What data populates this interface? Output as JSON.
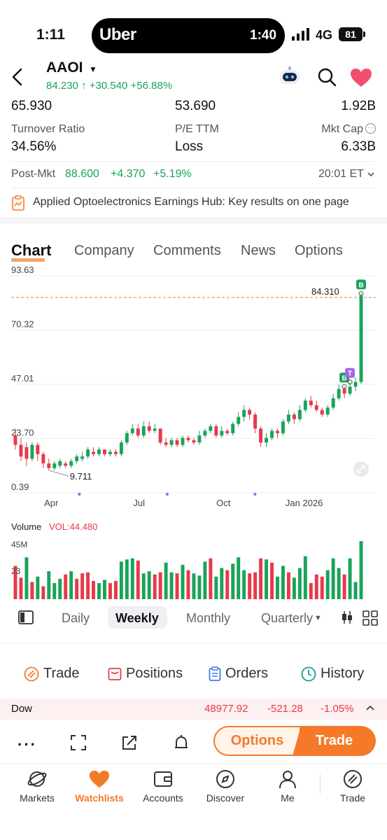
{
  "status_bar": {
    "time": "1:11",
    "island_brand": "Uber",
    "island_time": "1:40",
    "network": "4G",
    "battery": "81"
  },
  "header": {
    "ticker": "AAOI",
    "price": "84.230",
    "change": "+30.540",
    "change_pct": "+56.88%"
  },
  "stats": {
    "row1": [
      "65.930",
      "53.690",
      "1.92B"
    ],
    "row2_labels": [
      "Turnover Ratio",
      "P/E TTM",
      "Mkt Cap"
    ],
    "row2_values": [
      "34.56%",
      "Loss",
      "6.33B"
    ]
  },
  "post_market": {
    "label": "Post-Mkt",
    "price": "88.600",
    "change": "+4.370",
    "change_pct": "+5.19%",
    "time": "20:01 ET"
  },
  "banner": {
    "text": "Applied Optoelectronics Earnings Hub: Key results on one page"
  },
  "tabs": [
    "Chart",
    "Company",
    "Comments",
    "News",
    "Options"
  ],
  "chart_data": {
    "type": "candlestick",
    "y_ticks": [
      "93.63",
      "70.32",
      "47.01",
      "23.70",
      "0.39"
    ],
    "x_ticks": [
      "Apr",
      "Jul",
      "Oct",
      "Jan 2026"
    ],
    "ylim": [
      0.39,
      93.63
    ],
    "last_price_line": "84.310",
    "low_label": "9.711",
    "markers": [
      "B",
      "B",
      "T"
    ],
    "volume_label": "Volume",
    "volume_value": "VOL:44.480",
    "volume_ticks": [
      "45M",
      "23"
    ],
    "candles": [
      {
        "o": 25,
        "c": 21,
        "h": 28,
        "l": 19
      },
      {
        "o": 21,
        "c": 16,
        "h": 24,
        "l": 14
      },
      {
        "o": 20,
        "c": 15,
        "h": 22,
        "l": 12
      },
      {
        "o": 15,
        "c": 21,
        "h": 22,
        "l": 14
      },
      {
        "o": 21,
        "c": 17,
        "h": 22,
        "l": 14
      },
      {
        "o": 17,
        "c": 13,
        "h": 18,
        "l": 11
      },
      {
        "o": 13,
        "c": 11,
        "h": 15,
        "l": 10
      },
      {
        "o": 11,
        "c": 13,
        "h": 14,
        "l": 10
      },
      {
        "o": 12,
        "c": 14,
        "h": 15,
        "l": 11
      },
      {
        "o": 13,
        "c": 12,
        "h": 14,
        "l": 11
      },
      {
        "o": 12,
        "c": 14,
        "h": 15,
        "l": 11
      },
      {
        "o": 14,
        "c": 16,
        "h": 17,
        "l": 13
      },
      {
        "o": 15,
        "c": 16,
        "h": 18,
        "l": 14
      },
      {
        "o": 16,
        "c": 19,
        "h": 20,
        "l": 15
      },
      {
        "o": 18,
        "c": 17,
        "h": 20,
        "l": 16
      },
      {
        "o": 17,
        "c": 19,
        "h": 20,
        "l": 16
      },
      {
        "o": 19,
        "c": 17,
        "h": 19,
        "l": 16
      },
      {
        "o": 17,
        "c": 18,
        "h": 19,
        "l": 16
      },
      {
        "o": 18,
        "c": 17,
        "h": 19,
        "l": 16
      },
      {
        "o": 17,
        "c": 22,
        "h": 23,
        "l": 16
      },
      {
        "o": 22,
        "c": 26,
        "h": 27,
        "l": 21
      },
      {
        "o": 26,
        "c": 28,
        "h": 30,
        "l": 25
      },
      {
        "o": 28,
        "c": 25,
        "h": 30,
        "l": 24
      },
      {
        "o": 25,
        "c": 29,
        "h": 31,
        "l": 24
      },
      {
        "o": 29,
        "c": 27,
        "h": 31,
        "l": 26
      },
      {
        "o": 27,
        "c": 28,
        "h": 30,
        "l": 26
      },
      {
        "o": 28,
        "c": 22,
        "h": 28,
        "l": 21
      },
      {
        "o": 22,
        "c": 21,
        "h": 24,
        "l": 20
      },
      {
        "o": 21,
        "c": 23,
        "h": 24,
        "l": 20
      },
      {
        "o": 23,
        "c": 21,
        "h": 24,
        "l": 20
      },
      {
        "o": 21,
        "c": 24,
        "h": 25,
        "l": 20
      },
      {
        "o": 24,
        "c": 23,
        "h": 25,
        "l": 22
      },
      {
        "o": 23,
        "c": 22,
        "h": 24,
        "l": 21
      },
      {
        "o": 22,
        "c": 25,
        "h": 27,
        "l": 21
      },
      {
        "o": 25,
        "c": 27,
        "h": 28,
        "l": 24
      },
      {
        "o": 27,
        "c": 29,
        "h": 30,
        "l": 26
      },
      {
        "o": 29,
        "c": 25,
        "h": 30,
        "l": 24
      },
      {
        "o": 25,
        "c": 27,
        "h": 29,
        "l": 24
      },
      {
        "o": 27,
        "c": 26,
        "h": 28,
        "l": 25
      },
      {
        "o": 26,
        "c": 30,
        "h": 31,
        "l": 25
      },
      {
        "o": 30,
        "c": 33,
        "h": 35,
        "l": 29
      },
      {
        "o": 33,
        "c": 36,
        "h": 38,
        "l": 31
      },
      {
        "o": 36,
        "c": 34,
        "h": 37,
        "l": 32
      },
      {
        "o": 34,
        "c": 28,
        "h": 35,
        "l": 26
      },
      {
        "o": 28,
        "c": 22,
        "h": 29,
        "l": 20
      },
      {
        "o": 22,
        "c": 24,
        "h": 26,
        "l": 20
      },
      {
        "o": 24,
        "c": 27,
        "h": 28,
        "l": 23
      },
      {
        "o": 27,
        "c": 26,
        "h": 28,
        "l": 24
      },
      {
        "o": 26,
        "c": 31,
        "h": 32,
        "l": 25
      },
      {
        "o": 31,
        "c": 34,
        "h": 36,
        "l": 30
      },
      {
        "o": 34,
        "c": 32,
        "h": 35,
        "l": 30
      },
      {
        "o": 32,
        "c": 36,
        "h": 38,
        "l": 31
      },
      {
        "o": 36,
        "c": 40,
        "h": 41,
        "l": 35
      },
      {
        "o": 40,
        "c": 38,
        "h": 42,
        "l": 37
      },
      {
        "o": 38,
        "c": 36,
        "h": 40,
        "l": 35
      },
      {
        "o": 36,
        "c": 34,
        "h": 37,
        "l": 33
      },
      {
        "o": 34,
        "c": 37,
        "h": 38,
        "l": 33
      },
      {
        "o": 37,
        "c": 41,
        "h": 43,
        "l": 36
      },
      {
        "o": 41,
        "c": 45,
        "h": 47,
        "l": 40
      },
      {
        "o": 45,
        "c": 43,
        "h": 46,
        "l": 41
      },
      {
        "o": 43,
        "c": 46,
        "h": 48,
        "l": 42
      },
      {
        "o": 46,
        "c": 48,
        "h": 50,
        "l": 44
      },
      {
        "o": 48,
        "c": 85,
        "h": 86,
        "l": 47
      }
    ],
    "volumes": [
      31,
      20,
      39,
      16,
      21,
      12,
      26,
      15,
      19,
      23,
      26,
      19,
      24,
      25,
      17,
      15,
      18,
      15,
      17,
      35,
      37,
      38,
      36,
      24,
      26,
      23,
      25,
      34,
      25,
      24,
      32,
      27,
      24,
      22,
      35,
      38,
      21,
      29,
      27,
      33,
      39,
      27,
      24,
      25,
      38,
      37,
      34,
      21,
      31,
      25,
      20,
      29,
      40,
      15,
      23,
      21,
      27,
      38,
      29,
      23,
      38,
      16,
      54
    ],
    "volume_colors": [
      0,
      0,
      1,
      0,
      1,
      0,
      1,
      1,
      1,
      0,
      1,
      0,
      0,
      0,
      0,
      1,
      1,
      0,
      0,
      1,
      1,
      1,
      0,
      1,
      1,
      0,
      0,
      1,
      1,
      0,
      1,
      0,
      1,
      1,
      1,
      0,
      1,
      1,
      0,
      1,
      1,
      1,
      0,
      0,
      0,
      1,
      0,
      1,
      1,
      0,
      1,
      1,
      1,
      0,
      0,
      0,
      1,
      1,
      1,
      0,
      1,
      1,
      1
    ]
  },
  "periods": {
    "daily": "Daily",
    "weekly": "Weekly",
    "monthly": "Monthly",
    "quarterly": "Quarterly"
  },
  "actions": [
    "Trade",
    "Positions",
    "Orders",
    "History"
  ],
  "index": {
    "name": "Dow",
    "value": "48977.92",
    "change": "-521.28",
    "pct": "-1.05%"
  },
  "toolbar": {
    "options_label": "Options",
    "trade_label": "Trade"
  },
  "nav": [
    "Markets",
    "Watchlists",
    "Accounts",
    "Discover",
    "Me",
    "Trade"
  ],
  "colors": {
    "accent": "#f47a2a",
    "up": "#1aa35a",
    "down": "#e8394b"
  }
}
